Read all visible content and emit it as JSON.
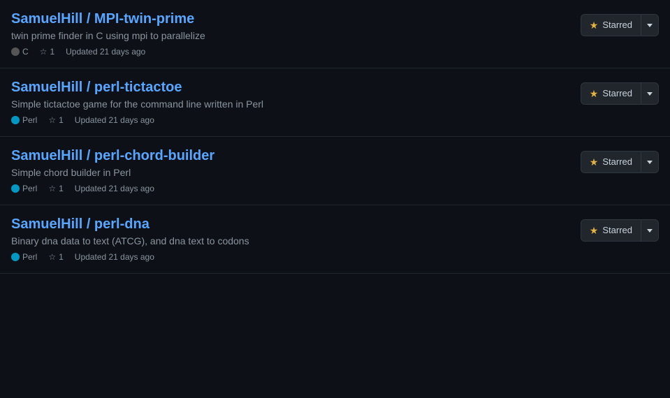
{
  "repos": [
    {
      "id": "mpi-twin-prime",
      "name": "SamuelHill / MPI-twin-prime",
      "description": "twin prime finder in C using mpi to parallelize",
      "language": "C",
      "language_color": "#555555",
      "language_class": "lang-c",
      "stars": "1",
      "updated": "Updated 21 days ago",
      "star_button_label": "Starred"
    },
    {
      "id": "perl-tictactoe",
      "name": "SamuelHill / perl-tictactoe",
      "description": "Simple tictactoe game for the command line written in Perl",
      "language": "Perl",
      "language_color": "#0298c3",
      "language_class": "lang-perl",
      "stars": "1",
      "updated": "Updated 21 days ago",
      "star_button_label": "Starred"
    },
    {
      "id": "perl-chord-builder",
      "name": "SamuelHill / perl-chord-builder",
      "description": "Simple chord builder in Perl",
      "language": "Perl",
      "language_color": "#0298c3",
      "language_class": "lang-perl",
      "stars": "1",
      "updated": "Updated 21 days ago",
      "star_button_label": "Starred"
    },
    {
      "id": "perl-dna",
      "name": "SamuelHill / perl-dna",
      "description": "Binary dna data to text (ATCG), and dna text to codons",
      "language": "Perl",
      "language_color": "#0298c3",
      "language_class": "lang-perl",
      "stars": "1",
      "updated": "Updated 21 days ago",
      "star_button_label": "Starred"
    }
  ],
  "icons": {
    "star_filled": "★",
    "star_empty": "☆",
    "chevron": "▾"
  }
}
